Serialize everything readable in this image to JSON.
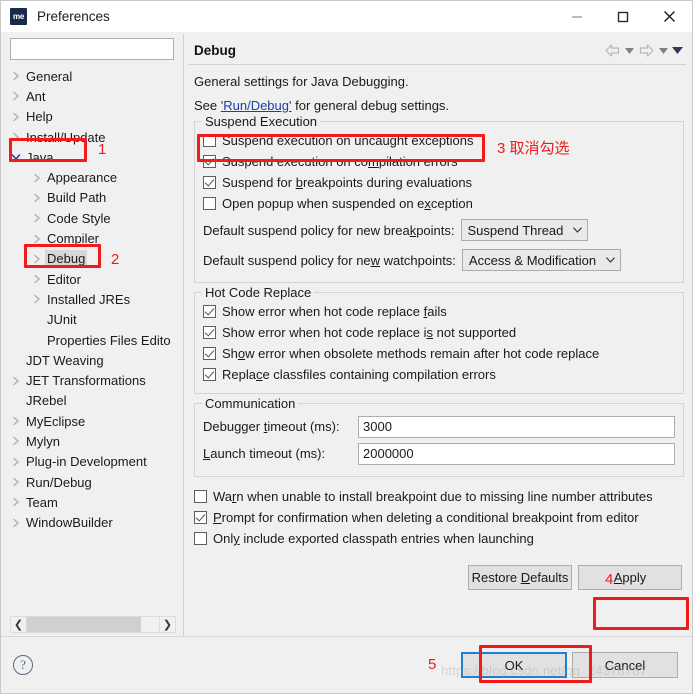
{
  "window": {
    "title": "Preferences",
    "app_icon_text": "me",
    "controls": {
      "minimize": "minimize-icon",
      "maximize": "maximize-icon",
      "close": "close-icon"
    }
  },
  "sidebar": {
    "filter_value": "",
    "filter_placeholder": "",
    "items": [
      {
        "label": "General",
        "level": 0,
        "twisty": "collapsed",
        "selected": false
      },
      {
        "label": "Ant",
        "level": 0,
        "twisty": "collapsed",
        "selected": false
      },
      {
        "label": "Help",
        "level": 0,
        "twisty": "collapsed",
        "selected": false
      },
      {
        "label": "Install/Update",
        "level": 0,
        "twisty": "collapsed",
        "selected": false
      },
      {
        "label": "Java",
        "level": 0,
        "twisty": "expanded",
        "selected": false
      },
      {
        "label": "Appearance",
        "level": 1,
        "twisty": "collapsed",
        "selected": false
      },
      {
        "label": "Build Path",
        "level": 1,
        "twisty": "collapsed",
        "selected": false
      },
      {
        "label": "Code Style",
        "level": 1,
        "twisty": "collapsed",
        "selected": false
      },
      {
        "label": "Compiler",
        "level": 1,
        "twisty": "collapsed",
        "selected": false
      },
      {
        "label": "Debug",
        "level": 1,
        "twisty": "collapsed",
        "selected": true
      },
      {
        "label": "Editor",
        "level": 1,
        "twisty": "collapsed",
        "selected": false
      },
      {
        "label": "Installed JREs",
        "level": 1,
        "twisty": "collapsed",
        "selected": false
      },
      {
        "label": "JUnit",
        "level": 1,
        "twisty": "none",
        "selected": false
      },
      {
        "label": "Properties Files Edito",
        "level": 1,
        "twisty": "none",
        "selected": false
      },
      {
        "label": "JDT Weaving",
        "level": 0,
        "twisty": "none",
        "selected": false
      },
      {
        "label": "JET Transformations",
        "level": 0,
        "twisty": "collapsed",
        "selected": false
      },
      {
        "label": "JRebel",
        "level": 0,
        "twisty": "none",
        "selected": false
      },
      {
        "label": "MyEclipse",
        "level": 0,
        "twisty": "collapsed",
        "selected": false
      },
      {
        "label": "Mylyn",
        "level": 0,
        "twisty": "collapsed",
        "selected": false
      },
      {
        "label": "Plug-in Development",
        "level": 0,
        "twisty": "collapsed",
        "selected": false
      },
      {
        "label": "Run/Debug",
        "level": 0,
        "twisty": "collapsed",
        "selected": false
      },
      {
        "label": "Team",
        "level": 0,
        "twisty": "collapsed",
        "selected": false
      },
      {
        "label": "WindowBuilder",
        "level": 0,
        "twisty": "collapsed",
        "selected": false
      }
    ],
    "scroll_left_icon": "chevron-left-icon",
    "scroll_right_icon": "chevron-right-icon"
  },
  "page": {
    "title": "Debug",
    "nav": {
      "back_icon": "back-arrow-icon",
      "back_caret_icon": "caret-down-icon",
      "forward_icon": "forward-arrow-icon",
      "forward_caret_icon": "caret-down-icon",
      "menu_icon": "view-menu-caret-icon"
    },
    "intro_1": "General settings for Java Debugging.",
    "intro_2_prefix": "See ",
    "intro_2_link": "'Run/Debug'",
    "intro_2_suffix": " for general debug settings.",
    "suspend_group": {
      "title": "Suspend Execution",
      "checkboxes": [
        {
          "label": "Suspend execution on uncaught exceptions",
          "checked": false
        },
        {
          "label": "Suspend execution on compilation errors",
          "checked": true
        },
        {
          "label": "Suspend for breakpoints during evaluations",
          "checked": true
        },
        {
          "label": "Open popup when suspended on exception",
          "checked": false
        }
      ],
      "breakpoint_policy_label": "Default suspend policy for new breakpoints:",
      "breakpoint_policy_value": "Suspend Thread",
      "watchpoint_policy_label": "Default suspend policy for new watchpoints:",
      "watchpoint_policy_value": "Access & Modification"
    },
    "hot_code_group": {
      "title": "Hot Code Replace",
      "checkboxes": [
        {
          "label": "Show error when hot code replace fails",
          "checked": true
        },
        {
          "label": "Show error when hot code replace is not supported",
          "checked": true
        },
        {
          "label": "Show error when obsolete methods remain after hot code replace",
          "checked": true
        },
        {
          "label": "Replace classfiles containing compilation errors",
          "checked": true
        }
      ]
    },
    "communication_group": {
      "title": "Communication",
      "fields": [
        {
          "label": "Debugger timeout (ms):",
          "value": "3000"
        },
        {
          "label": "Launch timeout (ms):",
          "value": "2000000"
        }
      ]
    },
    "loose_checkboxes": [
      {
        "label": "Warn when unable to install breakpoint due to missing line number attributes",
        "checked": false
      },
      {
        "label": "Prompt for confirmation when deleting a conditional breakpoint from editor",
        "checked": true
      },
      {
        "label": "Only include exported classpath entries when launching",
        "checked": false
      }
    ],
    "restore_defaults_label": "Restore Defaults",
    "apply_label": "Apply"
  },
  "footer": {
    "help_icon": "help-question-icon",
    "ok_label": "OK",
    "cancel_label": "Cancel",
    "watermark": "https://blog.csdn.net/qq_24378787"
  },
  "annotations": {
    "n1": "1",
    "n2": "2",
    "n3": "3 取消勾选",
    "n4": "4",
    "n5": "5",
    "color": "#ee1c1c"
  }
}
